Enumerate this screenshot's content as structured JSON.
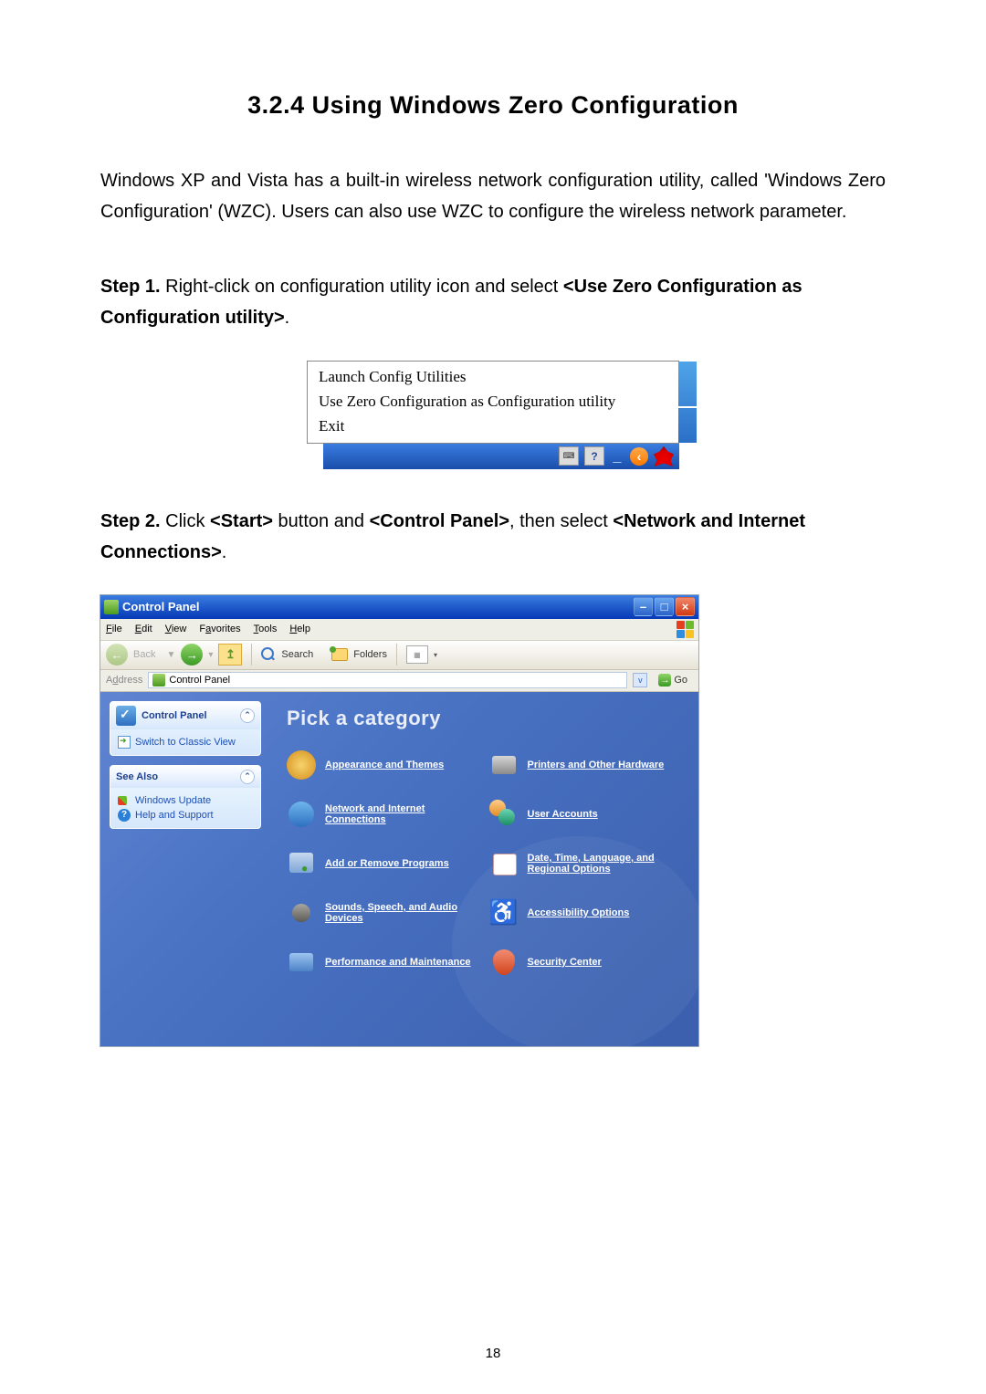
{
  "doc": {
    "heading": "3.2.4  Using Windows Zero Configuration",
    "intro": "Windows XP and Vista has a built-in wireless network configuration utility, called 'Windows Zero Configuration' (WZC). Users can also use WZC to configure the wireless network parameter.",
    "step1_label": "Step 1.",
    "step1_a": " Right-click on configuration utility icon and select ",
    "step1_b": "<Use Zero Configuration as Configuration utility>",
    "step1_c": ".",
    "step2_label": "Step 2.",
    "step2_a": " Click ",
    "step2_b": "<Start>",
    "step2_c": " button and ",
    "step2_d": "<Control Panel>",
    "step2_e": ", then select ",
    "step2_f": "<Network and Internet Connections>",
    "step2_g": ".",
    "pagenum": "18"
  },
  "ctx": {
    "item1": "Launch Config Utilities",
    "item2": "Use Zero Configuration as Configuration utility",
    "item3": "Exit"
  },
  "cp": {
    "title": "Control Panel",
    "menu": {
      "file": "File",
      "edit": "Edit",
      "view": "View",
      "favorites": "Favorites",
      "tools": "Tools",
      "help": "Help"
    },
    "toolbar": {
      "back": "Back",
      "search": "Search",
      "folders": "Folders"
    },
    "address": {
      "label": "Address",
      "value": "Control Panel",
      "go": "Go"
    },
    "side": {
      "box1_title": "Control Panel",
      "box1_link": "Switch to Classic View",
      "box2_title": "See Also",
      "box2_l1": "Windows Update",
      "box2_l2": "Help and Support"
    },
    "main": {
      "title": "Pick a category",
      "c1": "Appearance and Themes",
      "c2": "Printers and Other Hardware",
      "c3": "Network and Internet Connections",
      "c4": "User Accounts",
      "c5": "Add or Remove Programs",
      "c6": "Date, Time, Language, and Regional Options",
      "c7": "Sounds, Speech, and Audio Devices",
      "c8": "Accessibility Options",
      "c9": "Performance and Maintenance",
      "c10": "Security Center"
    }
  }
}
